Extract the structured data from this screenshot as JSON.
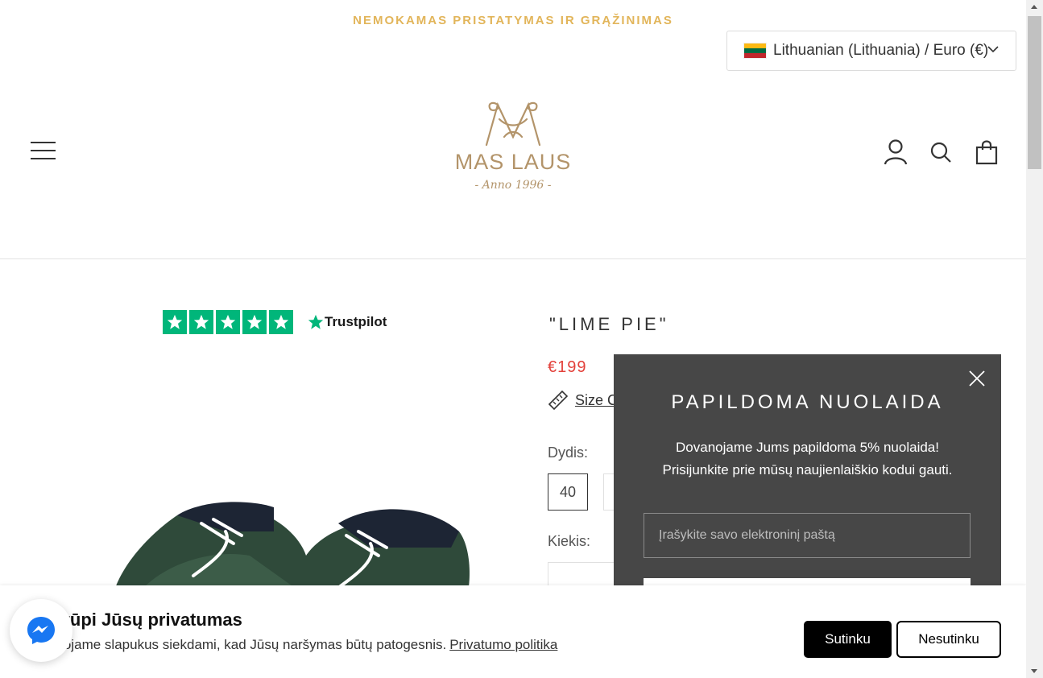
{
  "announcement": "NEMOKAMAS PRISTATYMAS IR GRĄŽINIMAS",
  "locale": {
    "label": "Lithuanian (Lithuania) / Euro (€)",
    "flag_colors": [
      "#fdb913",
      "#006a44",
      "#c1272d"
    ]
  },
  "logo": {
    "brand": "MAS LAUS",
    "anno": "- Anno 1996 -"
  },
  "header_icons": [
    "account-icon",
    "search-icon",
    "cart-icon"
  ],
  "trustpilot": {
    "word": "Trustpilot",
    "stars": 5,
    "color": "#00b67a"
  },
  "product": {
    "title": "\"LIME PIE\"",
    "price": "€199",
    "size_chart_label": "Size C",
    "size_label": "Dydis:",
    "selected_size": "40",
    "quantity_label": "Kiekis:"
  },
  "popup": {
    "title": "PAPILDOMA NUOLAIDA",
    "line1": "Dovanojame Jums papildoma 5% nuolaida!",
    "line2": "Prisijunkite prie mūsų naujienlaiškio kodui gauti.",
    "email_placeholder": "Įrašykite savo elektroninį paštą"
  },
  "cookie": {
    "title": "s rūpi Jūsų privatumas",
    "message": "udojame slapukus siekdami, kad Jūsų naršymas būtų patogesnis.",
    "policy_link": "Privatumo politika",
    "accept": "Sutinku",
    "decline": "Nesutinku"
  },
  "colors": {
    "announcement": "#e2b55a",
    "price": "#e3413b",
    "popup_bg": "#474747",
    "brand_gold": "#b3946a"
  }
}
